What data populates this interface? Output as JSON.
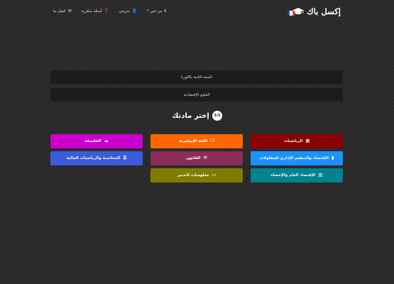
{
  "header": {
    "brand": "إكسل باك",
    "nav": [
      {
        "label": "من نحن ؟",
        "icon": "ℹ"
      },
      {
        "label": "تدريس",
        "icon": "👤"
      },
      {
        "label": "أسئلة متكررة",
        "icon": "❓"
      },
      {
        "label": "اتصل بنا",
        "icon": "✉"
      }
    ]
  },
  "path": {
    "level": "السنة الثانية بكالوريا",
    "branch": "العلوم الإقتصادية"
  },
  "step": {
    "badge": "3/3",
    "title": "إختر مادتك"
  },
  "subjects": [
    {
      "label": "الرياضيات",
      "icon": "▦",
      "color": "#8b0000"
    },
    {
      "label": "اللغة الإنجليزية",
      "icon": "❐",
      "color": "#ff6600"
    },
    {
      "label": "الفلسفة",
      "icon": "☁",
      "color": "#cc00cc"
    },
    {
      "label": "الإقتصاد والتنظيم الإداري للمقاولات",
      "icon": "▮",
      "color": "#1e90ff"
    },
    {
      "label": "القانون",
      "icon": "⚒",
      "color": "#8b2d5a"
    },
    {
      "label": "المحاسبة والرياضيات المالية",
      "icon": "₿",
      "color": "#3b5bdb"
    },
    {
      "label": "الإقتصاد العام والإحصاء",
      "icon": "▥",
      "color": "#00828f"
    },
    {
      "label": "معلوميات التدبير",
      "icon": "▭",
      "color": "#7f7d00"
    }
  ],
  "colors": {
    "flag_blue": "#0055a4",
    "flag_white": "#ffffff",
    "flag_red": "#ef4135"
  }
}
